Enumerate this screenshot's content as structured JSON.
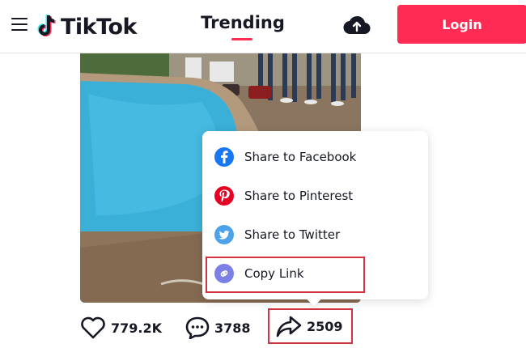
{
  "header": {
    "logo_text": "TikTok",
    "nav_trending": "Trending",
    "login_label": "Login",
    "brand_color": "#fe2c55",
    "icons": [
      "menu-icon",
      "tiktok-logo-icon",
      "upload-cloud-icon"
    ]
  },
  "share_menu": {
    "items": [
      {
        "label": "Share to Facebook",
        "icon": "facebook-icon",
        "color": "#1877f2"
      },
      {
        "label": "Share to Pinterest",
        "icon": "pinterest-icon",
        "color": "#e60023"
      },
      {
        "label": "Share to Twitter",
        "icon": "twitter-icon",
        "color": "#4ea3e8"
      },
      {
        "label": "Copy Link",
        "icon": "link-icon",
        "color": "#7b7fe6"
      }
    ]
  },
  "actions": {
    "likes": "779.2K",
    "comments": "3788",
    "shares": "2509"
  },
  "highlight_color": "#d23341"
}
